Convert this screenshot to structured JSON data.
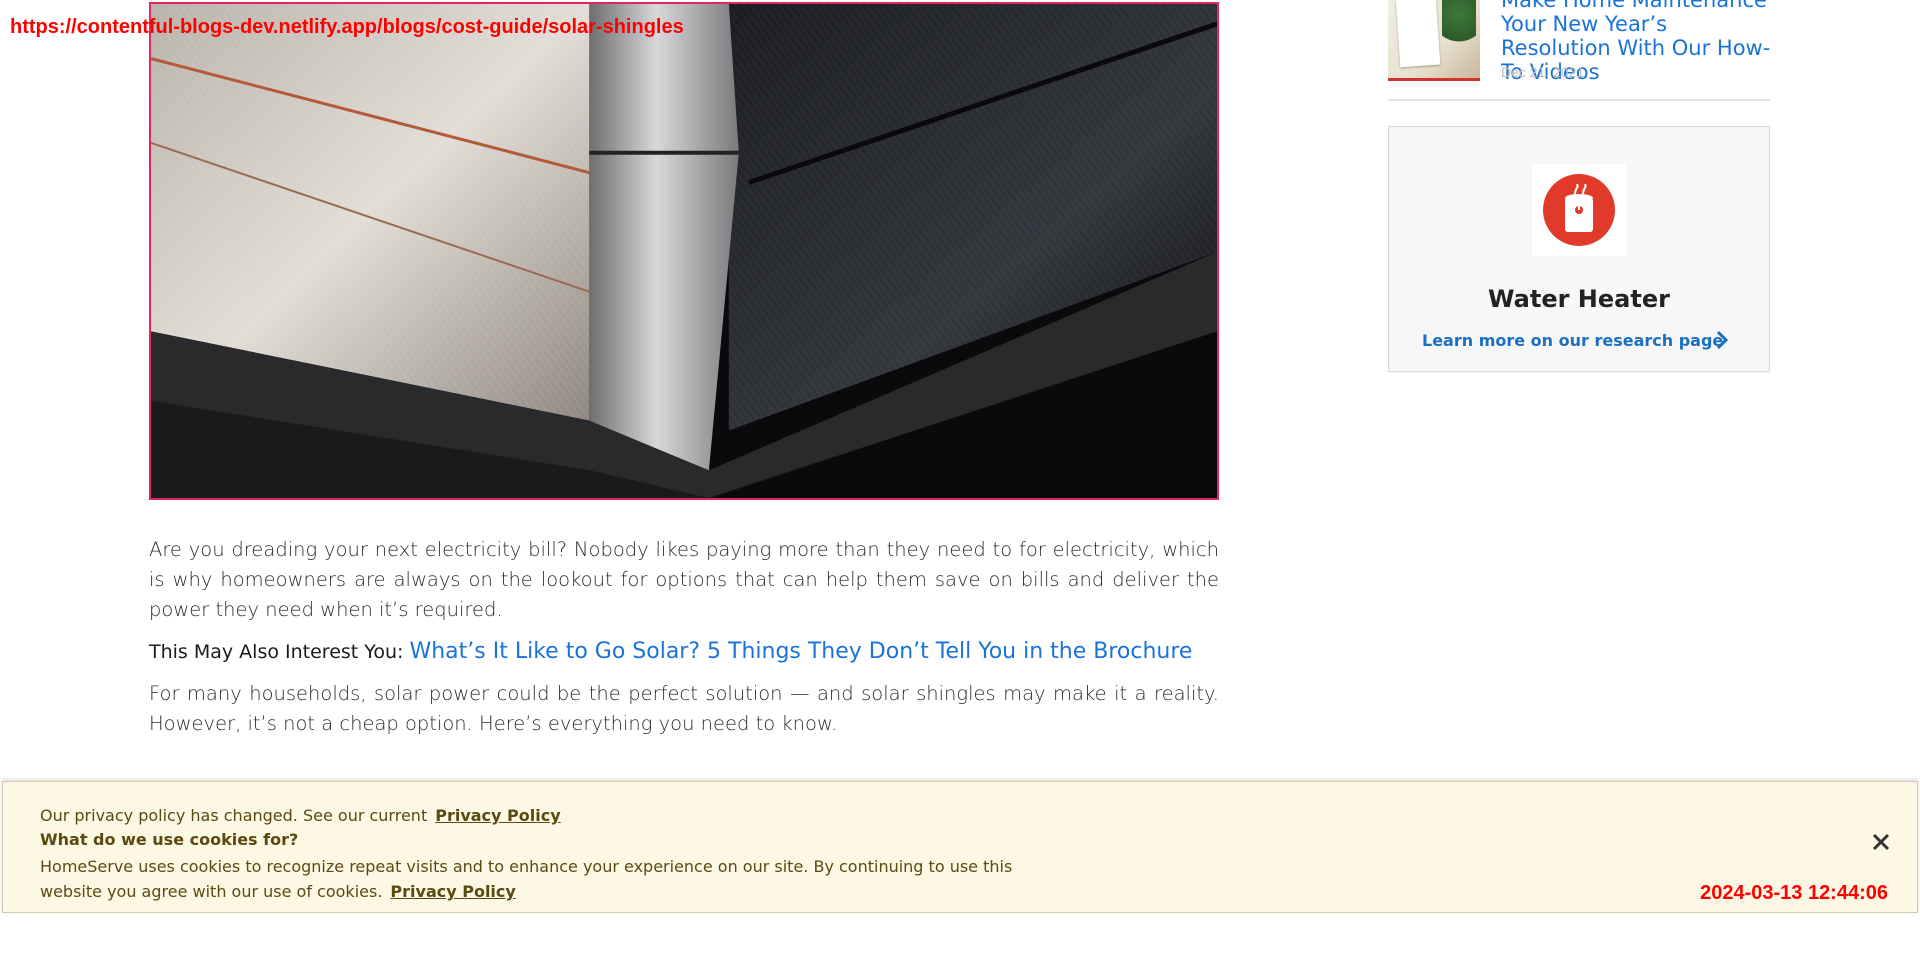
{
  "overlay": {
    "url": "https://contentful-blogs-dev.netlify.app/blogs/cost-guide/solar-shingles",
    "timestamp": "2024-03-13 12:44:06"
  },
  "hero": {
    "icon": "solar-shingle-roof-image"
  },
  "article": {
    "para1": "Are you dreading your next electricity bill? Nobody likes paying more than they need to for electricity, which is why homeowners are always on the lookout for options that can help them save on bills and deliver the power they need when it’s required.",
    "interest_label": "This May Also Interest You:",
    "interest_link": "What’s It Like to Go Solar? 5 Things They Don’t Tell You in the Brochure",
    "para2": "For many households, solar power could be the perfect solution — and solar shingles may make it a reality. However, it’s not a cheap option. Here’s everything you need to know."
  },
  "sidebar": {
    "post": {
      "title": "Make Home Maintenance Your New Year’s Resolution With Our How-To Videos",
      "date": "Dec 21, 2021"
    },
    "card": {
      "title": "Water Heater",
      "link": "Learn more on our research page",
      "icon": "water-heater-icon"
    }
  },
  "cookie": {
    "line1": "Our privacy policy has changed. See our current",
    "line1_link": "Privacy Policy",
    "line2": "What do we use cookies for?",
    "line3": "HomeServe uses cookies to recognize repeat visits and to enhance your experience on our site. By continuing to use this website you agree with our use of cookies.",
    "line3_link": "Privacy Policy"
  },
  "colors": {
    "link": "#1a73d8",
    "brand_red": "#e23a2a",
    "banner_bg": "#fdf8e3"
  }
}
